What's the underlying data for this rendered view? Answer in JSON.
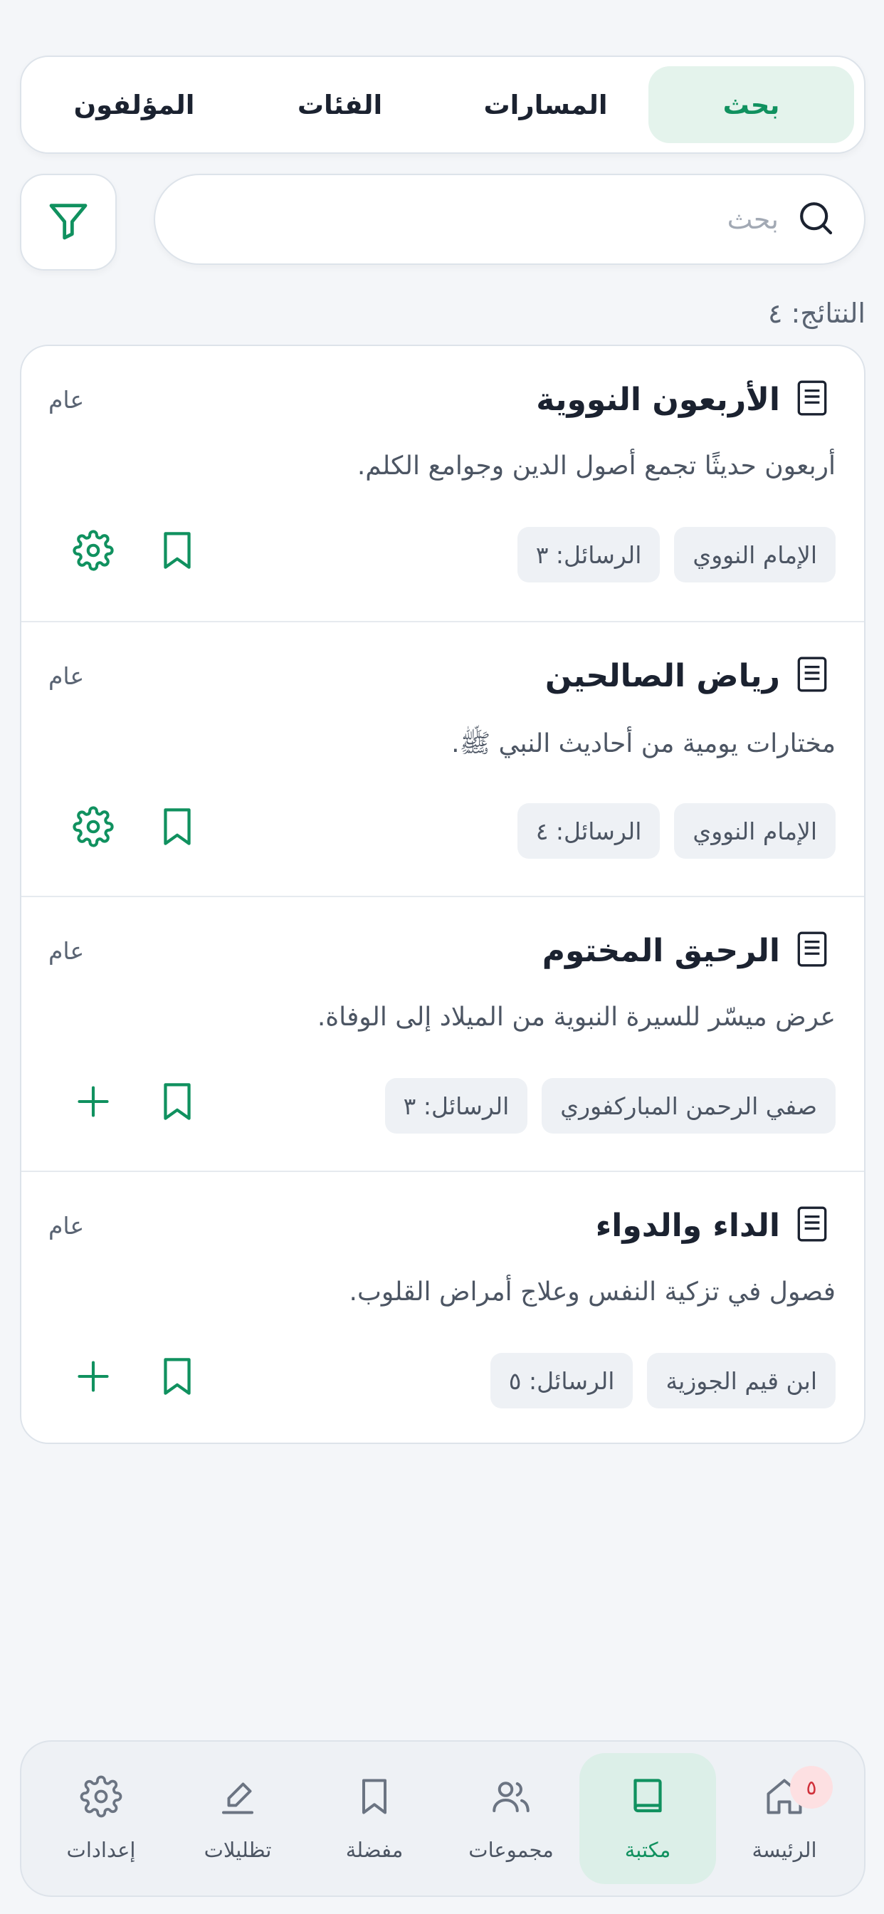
{
  "tabs": [
    {
      "label": "بحث",
      "active": true
    },
    {
      "label": "المسارات",
      "active": false
    },
    {
      "label": "الفئات",
      "active": false
    },
    {
      "label": "المؤلفون",
      "active": false
    }
  ],
  "search": {
    "placeholder": "بحث",
    "value": ""
  },
  "results_count": "النتائج: ٤",
  "items": [
    {
      "title": "الأربعون النووية",
      "badge": "عام",
      "description": "أربعون حديثًا تجمع أصول الدين وجوامع الكلم.",
      "author": "الإمام النووي",
      "messages": "الرسائل: ٣",
      "primary_action": "gear-icon"
    },
    {
      "title": "رياض الصالحين",
      "badge": "عام",
      "description": "مختارات يومية من أحاديث النبي ﷺ.",
      "author": "الإمام النووي",
      "messages": "الرسائل: ٤",
      "primary_action": "gear-icon"
    },
    {
      "title": "الرحيق المختوم",
      "badge": "عام",
      "description": "عرض ميسّر للسيرة النبوية من الميلاد إلى الوفاة.",
      "author": "صفي الرحمن المباركفوري",
      "messages": "الرسائل: ٣",
      "primary_action": "plus-icon"
    },
    {
      "title": "الداء والدواء",
      "badge": "عام",
      "description": "فصول في تزكية النفس وعلاج أمراض القلوب.",
      "author": "ابن قيم الجوزية",
      "messages": "الرسائل: ٥",
      "primary_action": "plus-icon"
    }
  ],
  "bottom_nav": [
    {
      "label": "الرئيسة",
      "icon": "home-icon",
      "badge": "٥",
      "active": false
    },
    {
      "label": "مكتبة",
      "icon": "book-icon",
      "active": true
    },
    {
      "label": "مجموعات",
      "icon": "users-icon",
      "active": false
    },
    {
      "label": "مفضلة",
      "icon": "bookmark-icon",
      "active": false
    },
    {
      "label": "تظليلات",
      "icon": "highlighter-icon",
      "active": false
    },
    {
      "label": "إعدادات",
      "icon": "settings-icon",
      "active": false
    }
  ],
  "colors": {
    "accent": "#10915f",
    "accent_bg": "#e4f3ec",
    "badge_red": "#d0303a"
  }
}
